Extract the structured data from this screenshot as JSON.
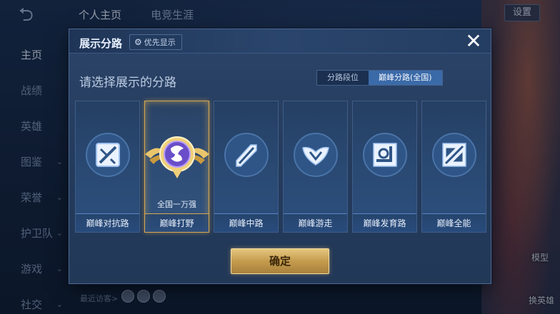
{
  "colors": {
    "modal_bg": "#2b4468",
    "accent_blue": "#3b6aa8",
    "gold": "#d6a852",
    "confirm_gold": "#c59b4e"
  },
  "background": {
    "top_tabs": [
      "个人主页",
      "电竞生涯"
    ],
    "settings_label": "设置",
    "sidebar": [
      {
        "label": "主页",
        "active": true
      },
      {
        "label": "战绩",
        "active": false
      },
      {
        "label": "英雄",
        "active": false
      },
      {
        "label": "图鉴",
        "active": false
      },
      {
        "label": "荣誉",
        "active": false
      },
      {
        "label": "护卫队",
        "active": false
      },
      {
        "label": "游戏",
        "active": false
      },
      {
        "label": "社交",
        "active": false
      }
    ],
    "recent_visitors_label": "最近访客>",
    "right_links": [
      "模型",
      "换英雄"
    ]
  },
  "modal": {
    "title": "展示分路",
    "priority_button": "优先显示",
    "priority_icon": "gear-icon",
    "close_icon": "close-icon",
    "subtitle": "请选择展示的分路",
    "segments": [
      {
        "label": "分路段位",
        "active": false
      },
      {
        "label": "巅峰分路(全国)",
        "active": true
      }
    ],
    "lanes": [
      {
        "label": "巅峰对抗路",
        "icon": "clash-lane-icon",
        "selected": false
      },
      {
        "label": "巅峰打野",
        "icon": "jungle-badge-icon",
        "selected": true,
        "rank": "全国一万强"
      },
      {
        "label": "巅峰中路",
        "icon": "mid-lane-icon",
        "selected": false
      },
      {
        "label": "巅峰游走",
        "icon": "roam-icon",
        "selected": false
      },
      {
        "label": "巅峰发育路",
        "icon": "farm-lane-icon",
        "selected": false
      },
      {
        "label": "巅峰全能",
        "icon": "all-round-icon",
        "selected": false
      }
    ],
    "confirm_label": "确定"
  }
}
